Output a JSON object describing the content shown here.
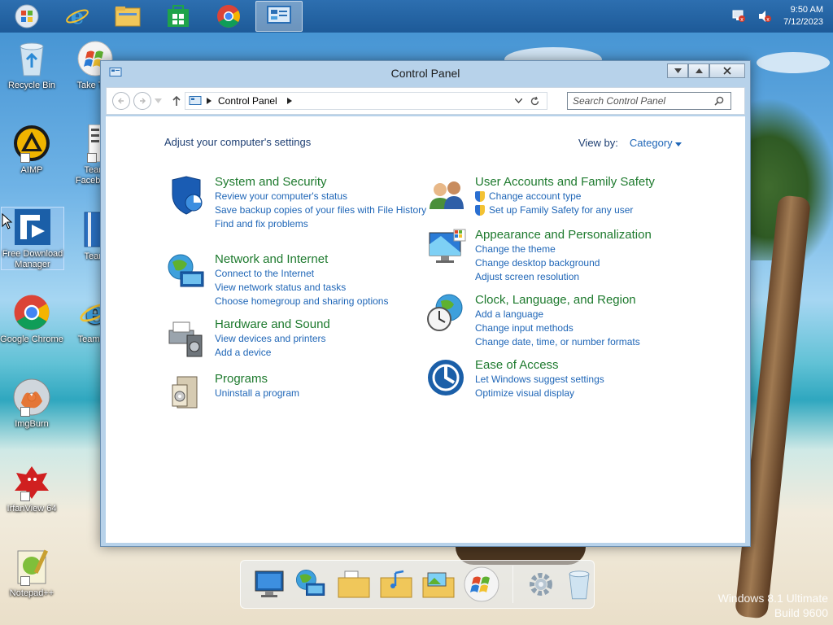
{
  "taskbar": {
    "pinned": [
      "start",
      "internet-explorer",
      "file-explorer",
      "store",
      "chrome",
      "control-panel"
    ],
    "clock_time": "9:50 AM",
    "clock_date": "7/12/2023"
  },
  "desktop": {
    "icons": [
      {
        "label": "Recycle Bin"
      },
      {
        "label": "Take The"
      },
      {
        "label": "AIMP"
      },
      {
        "label": "Team Facebook"
      },
      {
        "label": "Free Download Manager"
      },
      {
        "label": "Team"
      },
      {
        "label": "Google Chrome"
      },
      {
        "label": "TeamOS"
      },
      {
        "label": "ImgBurn"
      },
      {
        "label": "IrfanView 64"
      },
      {
        "label": "Notepad++"
      }
    ]
  },
  "window": {
    "title": "Control Panel",
    "breadcrumb": "Control Panel",
    "search_placeholder": "Search Control Panel",
    "heading": "Adjust your computer's settings",
    "view_by_label": "View by:",
    "view_by_value": "Category",
    "categories": [
      {
        "title": "System and Security",
        "links": [
          "Review your computer's status",
          "Save backup copies of your files with File History",
          "Find and fix problems"
        ]
      },
      {
        "title": "Network and Internet",
        "links": [
          "Connect to the Internet",
          "View network status and tasks",
          "Choose homegroup and sharing options"
        ]
      },
      {
        "title": "Hardware and Sound",
        "links": [
          "View devices and printers",
          "Add a device"
        ]
      },
      {
        "title": "Programs",
        "links": [
          "Uninstall a program"
        ]
      },
      {
        "title": "User Accounts and Family Safety",
        "links": [
          "Change account type",
          "Set up Family Safety for any user"
        ]
      },
      {
        "title": "Appearance and Personalization",
        "links": [
          "Change the theme",
          "Change desktop background",
          "Adjust screen resolution"
        ]
      },
      {
        "title": "Clock, Language, and Region",
        "links": [
          "Add a language",
          "Change input methods",
          "Change date, time, or number formats"
        ]
      },
      {
        "title": "Ease of Access",
        "links": [
          "Let Windows suggest settings",
          "Optimize visual display"
        ]
      }
    ]
  },
  "watermark": {
    "line1": "Windows 8.1 Ultimate",
    "line2": "Build 9600"
  },
  "colors": {
    "category_title": "#1e7a2e",
    "link": "#1f66b7",
    "taskbar": "#1d5a98"
  }
}
